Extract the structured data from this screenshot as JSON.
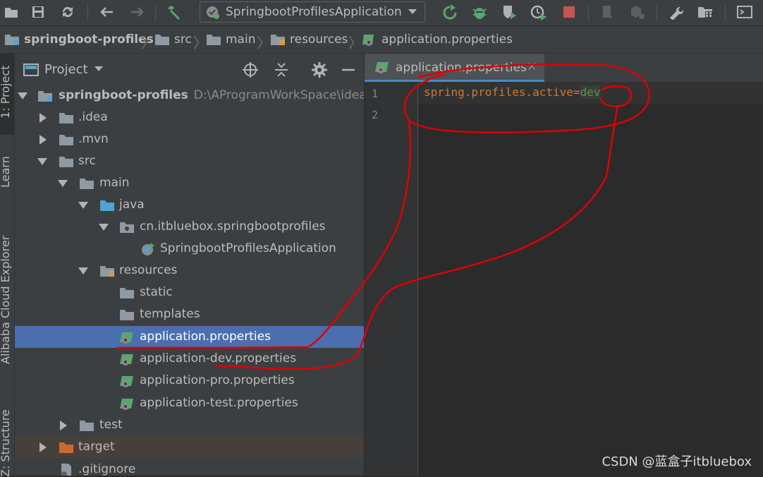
{
  "toolbar": {
    "run_config_label": "SpringbootProfilesApplication"
  },
  "breadcrumb": [
    "springboot-profiles",
    "src",
    "main",
    "resources",
    "application.properties"
  ],
  "tool_windows": {
    "project_tab": "1: Project",
    "learn_tab": "Learn",
    "cloud_tab": "Alibaba Cloud Explorer",
    "structure_tab": "Z: Structure"
  },
  "project_panel": {
    "title": "Project"
  },
  "tree": {
    "root_name": "springboot-profiles",
    "root_path": "D:\\AProgramWorkSpace\\idea\\sp",
    "idea": ".idea",
    "mvn": ".mvn",
    "src": "src",
    "main": "main",
    "java": "java",
    "package": "cn.itbluebox.springbootprofiles",
    "app_class": "SpringbootProfilesApplication",
    "resources": "resources",
    "static": "static",
    "templates": "templates",
    "app_props": "application.properties",
    "app_dev": "application-dev.properties",
    "app_pro": "application-pro.properties",
    "app_test": "application-test.properties",
    "test": "test",
    "target": "target",
    "gitignore": ".gitignore"
  },
  "editor": {
    "tab_name": "application.properties",
    "line_numbers": [
      "1",
      "2"
    ],
    "key": "spring.profiles.active",
    "eq": "=",
    "value": "dev"
  },
  "watermark": "CSDN @蓝盒子itbluebox",
  "colors": {
    "selection": "#4b6eaf",
    "annotation": "#e00000",
    "key": "#cc7832",
    "value": "#6a8759"
  }
}
